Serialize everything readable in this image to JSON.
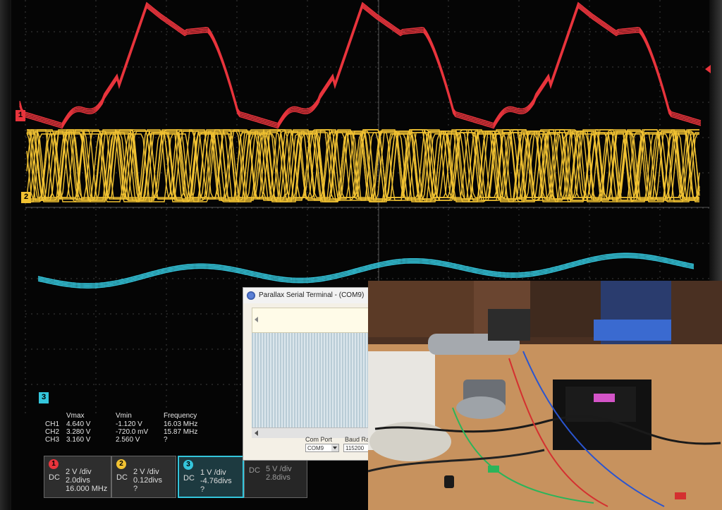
{
  "scope": {
    "channel_markers": [
      "1",
      "2",
      "3"
    ],
    "measurements": {
      "headers": {
        "vmax": "Vmax",
        "vmin": "Vmin",
        "frequency": "Frequency"
      },
      "rows": [
        {
          "channel": "CH1",
          "vmax": "4.640 V",
          "vmin": "-1.120 V",
          "frequency": "16.03 MHz"
        },
        {
          "channel": "CH2",
          "vmax": "3.280 V",
          "vmin": "-720.0 mV",
          "frequency": "15.87 MHz"
        },
        {
          "channel": "CH3",
          "vmax": "3.160 V",
          "vmin": "2.560 V",
          "frequency": "?"
        }
      ]
    },
    "channel_boxes": [
      {
        "num": "1",
        "coupling": "DC",
        "vdiv": "2 V /div",
        "offset": "2.0divs",
        "extra": "16.000 MHz",
        "color": "#e8343c"
      },
      {
        "num": "2",
        "coupling": "DC",
        "vdiv": "2 V /div",
        "offset": "0.12divs",
        "extra": "?",
        "color": "#f1c232"
      },
      {
        "num": "3",
        "coupling": "DC",
        "vdiv": "1 V /div",
        "offset": "-4.76divs",
        "extra": "?",
        "color": "#34c6dc"
      },
      {
        "num": "4",
        "coupling": "DC",
        "vdiv": "5 V /div",
        "offset": "2.8divs",
        "extra": "",
        "color": "#44c24a"
      }
    ],
    "colors": {
      "ch1": "#e8343c",
      "ch2": "#f1c232",
      "ch3": "#34c6dc",
      "grid": "#3d3d3d"
    }
  },
  "terminal": {
    "title": "Parallax Serial Terminal - (COM9)",
    "com_port_label": "Com Port",
    "com_port_value": "COM9",
    "baud_label": "Baud Ra",
    "baud_value": "115200"
  }
}
